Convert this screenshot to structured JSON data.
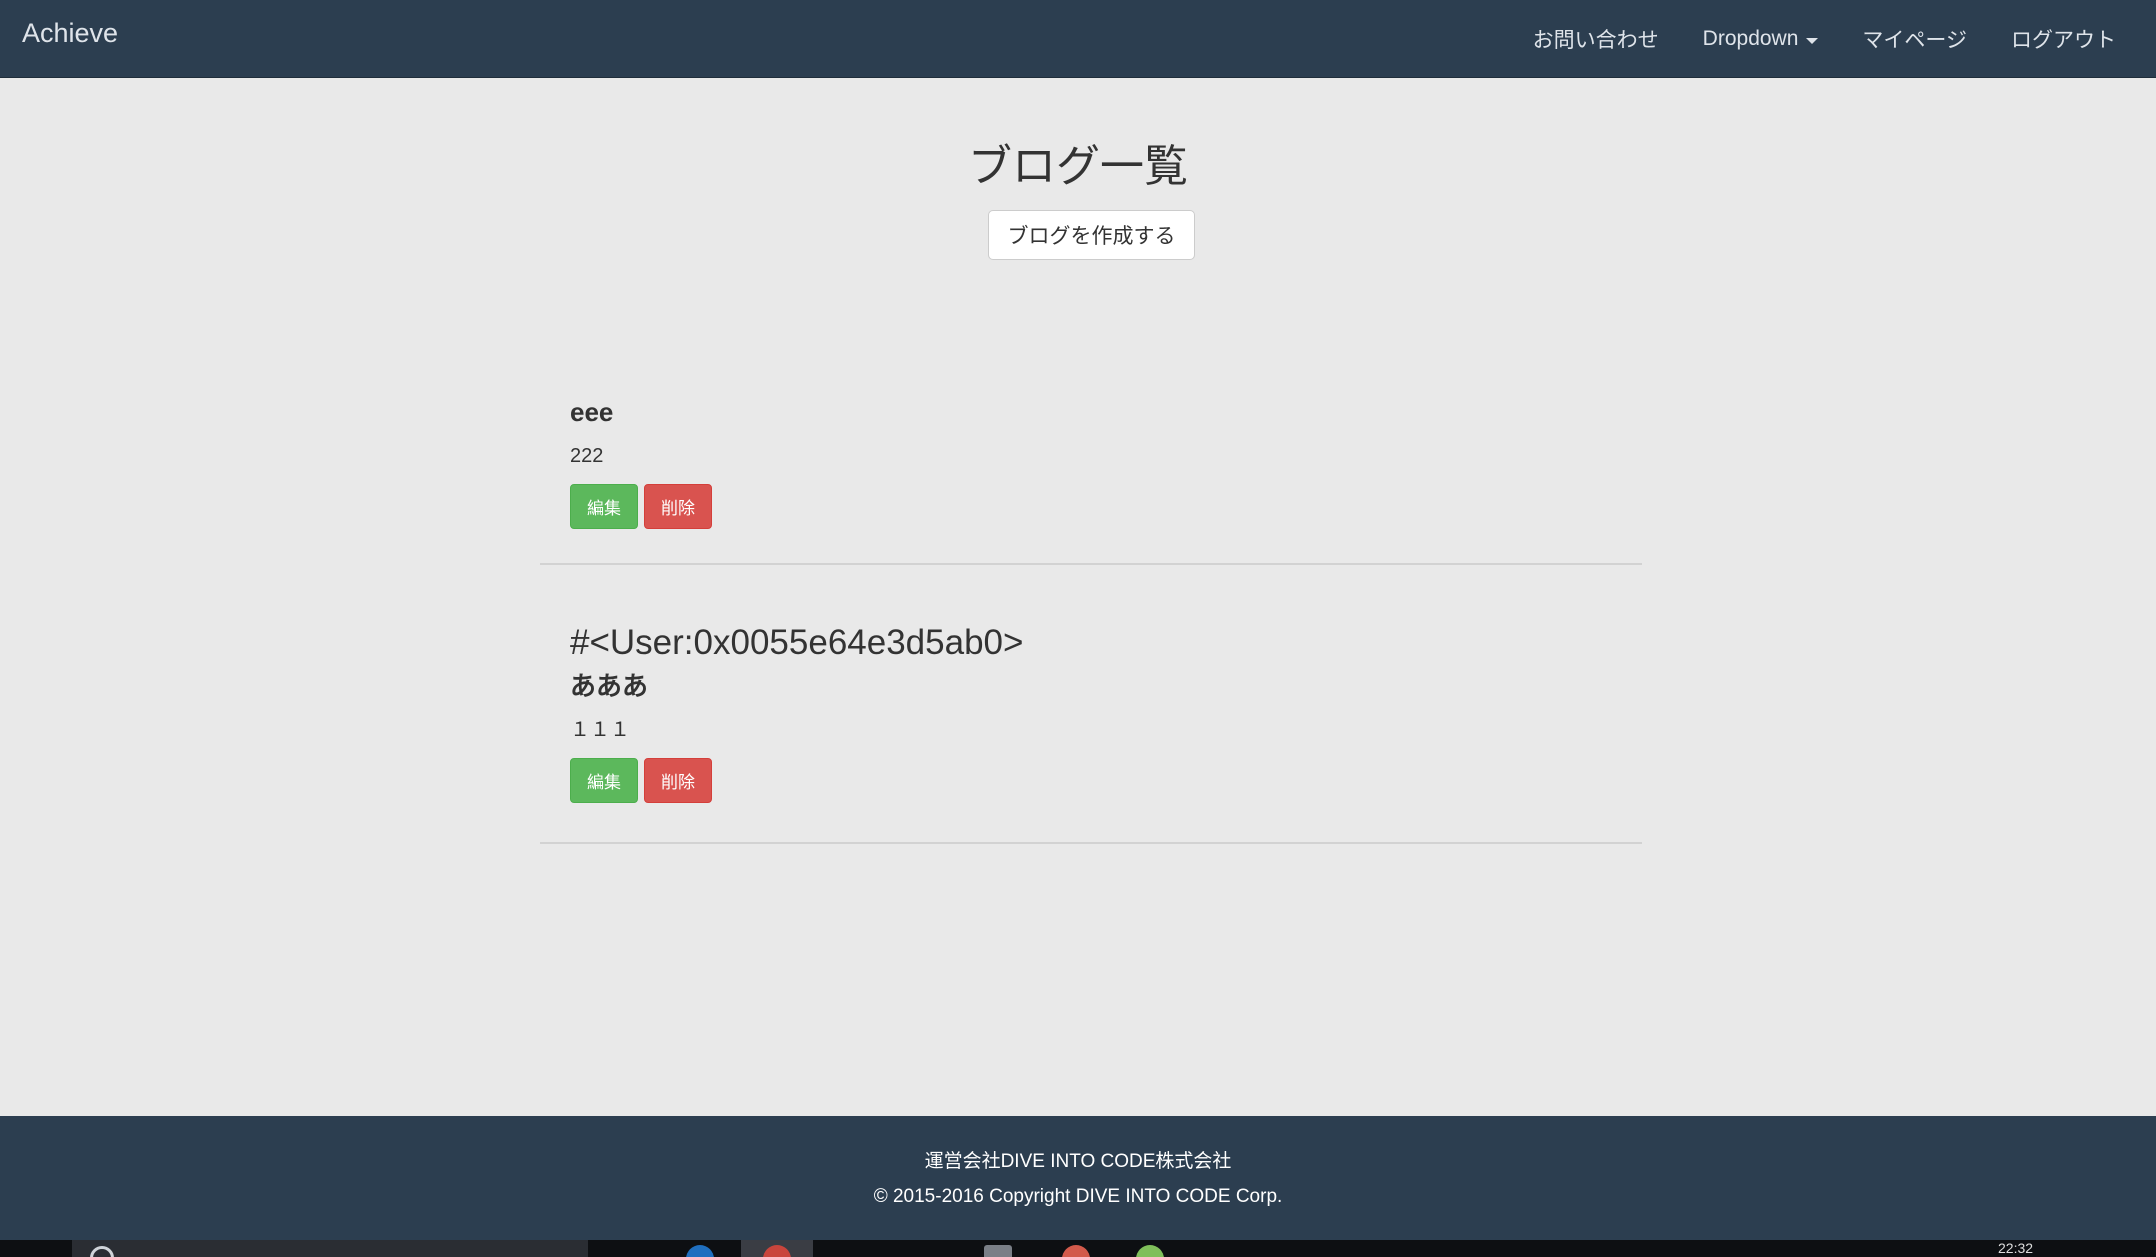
{
  "navbar": {
    "brand": "Achieve",
    "items": [
      {
        "label": "お問い合わせ"
      },
      {
        "label": "Dropdown"
      },
      {
        "label": "マイページ"
      },
      {
        "label": "ログアウト"
      }
    ]
  },
  "main": {
    "title": "ブログ一覧",
    "create_button": "ブログを作成する",
    "blogs": [
      {
        "user": "",
        "title": "eee",
        "content": "222",
        "edit_label": "編集",
        "delete_label": "削除"
      },
      {
        "user": "#<User:0x0055e64e3d5ab0>",
        "title": "あああ",
        "content": "１１１",
        "edit_label": "編集",
        "delete_label": "削除"
      }
    ]
  },
  "footer": {
    "company": "運営会社DIVE INTO CODE株式会社",
    "copyright": "© 2015-2016 Copyright DIVE INTO CODE Corp."
  },
  "taskbar": {
    "clock": "22:32"
  },
  "colors": {
    "navbar": "#2c3e50",
    "background": "#e9e9e9",
    "edit_button": "#5cb85c",
    "delete_button": "#d9534f"
  }
}
